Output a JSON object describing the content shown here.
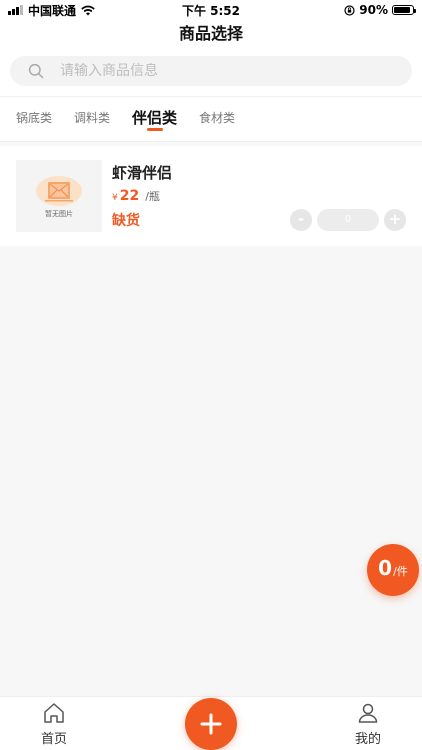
{
  "status_bar": {
    "carrier": "中国联通",
    "time": "下午 5:52",
    "battery": "90%",
    "battery_level": 0.9
  },
  "header": {
    "title": "商品选择"
  },
  "search": {
    "placeholder": "请输入商品信息",
    "value": ""
  },
  "tabs": [
    {
      "label": "锅底类",
      "active": false
    },
    {
      "label": "调料类",
      "active": false
    },
    {
      "label": "伴侣类",
      "active": true
    },
    {
      "label": "食材类",
      "active": false
    }
  ],
  "products": [
    {
      "name": "虾滑伴侣",
      "image_placeholder": "暂无图片",
      "currency": "¥",
      "price": "22",
      "unit": "/瓶",
      "status": "缺货",
      "quantity": "0",
      "minus_label": "-",
      "plus_label": "+"
    }
  ],
  "cart": {
    "count": "0",
    "unit": "/件"
  },
  "bottom_nav": {
    "home_label": "首页",
    "mine_label": "我的"
  },
  "colors": {
    "accent": "#f05a22",
    "background": "#f7f7f7",
    "card": "#ffffff"
  },
  "icons": {
    "search": "search-icon",
    "home": "home-icon",
    "user": "user-icon",
    "add": "plus-icon",
    "image_placeholder": "image-placeholder-icon",
    "wifi": "wifi-icon",
    "signal": "signal-icon",
    "battery": "battery-icon",
    "lock_rotation": "orientation-lock-icon"
  }
}
